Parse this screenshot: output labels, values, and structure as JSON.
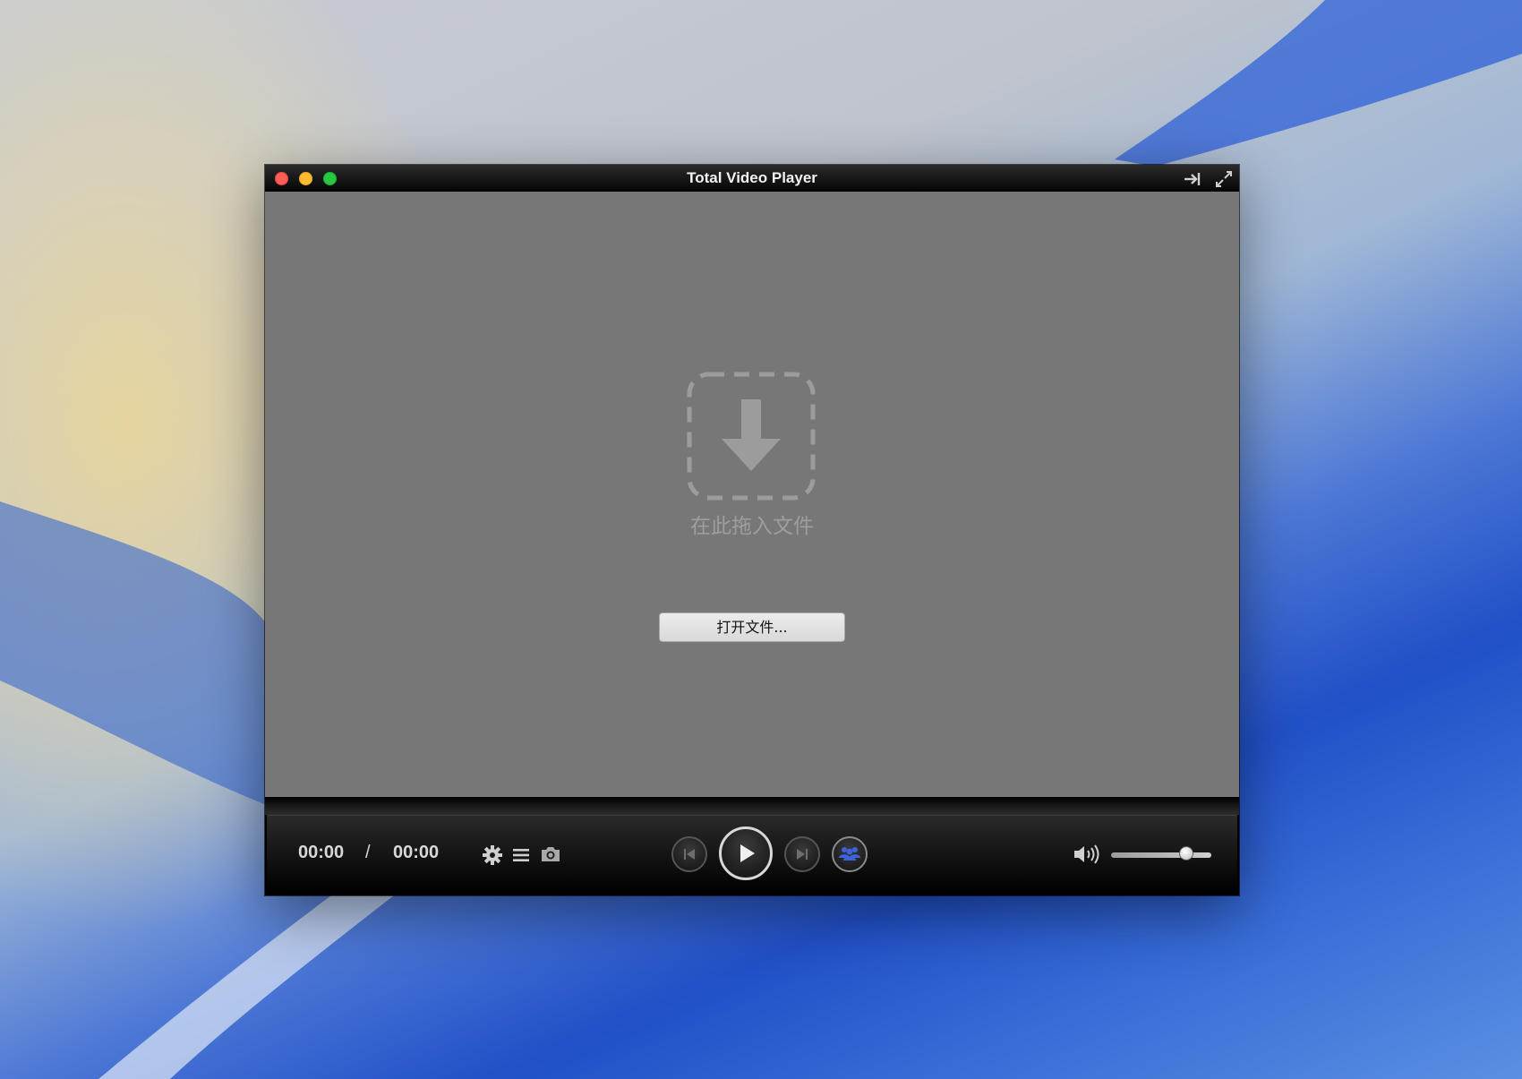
{
  "window": {
    "title": "Total Video Player"
  },
  "drop_area": {
    "hint": "在此拖入文件",
    "open_button": "打开文件..."
  },
  "controls": {
    "current_time": "00:00",
    "separator": "/",
    "duration": "00:00",
    "volume_level": 0.75,
    "icons": [
      "gear-icon",
      "playlist-icon",
      "camera-icon",
      "previous-icon",
      "play-icon",
      "next-icon",
      "group-icon",
      "volume-icon"
    ]
  },
  "colors": {
    "content_bg": "#777777",
    "accent_blue": "#3b63e0",
    "close": "#ff5f57",
    "minimize": "#febc2e",
    "zoom": "#28c840"
  }
}
